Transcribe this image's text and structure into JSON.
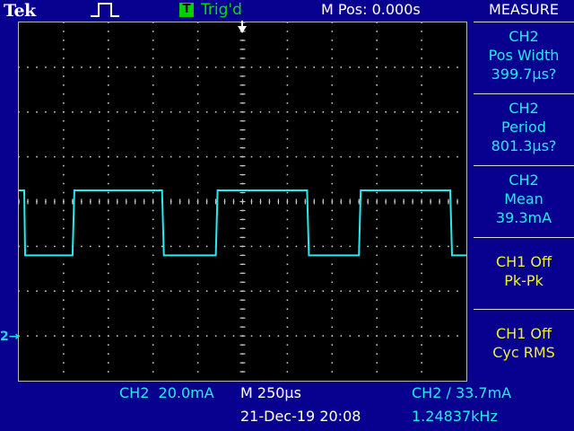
{
  "header": {
    "brand": "Tek",
    "run_icon": "square-pulse-icon",
    "trigger_badge": "T",
    "trigger_status": "Trig'd",
    "m_pos": "M Pos: 0.000s"
  },
  "measure": {
    "title": "MEASURE",
    "items": [
      {
        "source": "CH2",
        "name": "Pos Width",
        "value": "399.7µs?"
      },
      {
        "source": "CH2",
        "name": "Period",
        "value": "801.3µs?"
      },
      {
        "source": "CH2",
        "name": "Mean",
        "value": "39.3mA"
      },
      {
        "source": "CH1 Off",
        "name": "Pk-Pk",
        "value": ""
      },
      {
        "source": "CH1 Off",
        "name": "Cyc RMS",
        "value": ""
      }
    ]
  },
  "footer": {
    "ch2_scale": "CH2  20.0mA",
    "timebase": "M 250µs",
    "trigger_level": "CH2 ∕ 33.7mA",
    "datetime": "21-Dec-19 20:08",
    "frequency": "1.24837kHz"
  },
  "markers": {
    "ch2_ground": "2→"
  },
  "colors": {
    "background": "#08008f",
    "trace": "#22ecf2",
    "trig_green": "#00e000",
    "ch1_yellow": "#f0ee3a",
    "grid": "#c8c8c8"
  },
  "chart_data": {
    "type": "line",
    "series": [
      {
        "x": [
          0,
          0.03,
          0.035,
          0.3,
          0.31,
          0.8,
          0.81,
          1.1,
          1.11,
          1.61,
          1.62,
          1.9,
          1.91,
          2.41,
          2.42,
          2.5
        ],
        "values": [
          35,
          35,
          6,
          6,
          35,
          35,
          6,
          6,
          35,
          35,
          6,
          6,
          35,
          35,
          6,
          6
        ]
      }
    ],
    "x_units": "ms",
    "y_units": "mA",
    "xlim": [
      0,
      2.5
    ],
    "ylim": [
      -50,
      110
    ],
    "grid": true
  }
}
